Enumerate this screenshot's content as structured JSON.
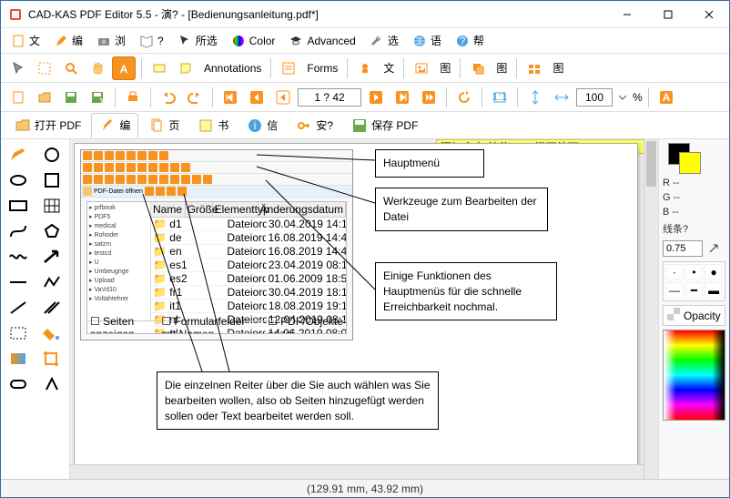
{
  "window": {
    "title": "CAD-KAS PDF Editor 5.5 - 演? - [Bedienungsanleitung.pdf*]"
  },
  "menu": {
    "file": "文",
    "edit": "编",
    "tools": "浏",
    "help": "?",
    "select": "所选",
    "color": "Color",
    "advanced": "Advanced",
    "options": "选",
    "lang": "语",
    "help2": "帮"
  },
  "toolbar1": {
    "annotations": "Annotations",
    "forms": "Forms",
    "text": "文",
    "pic": "图",
    "pic2": "图",
    "pic3": "图"
  },
  "toolbar2": {
    "page_field": "1 ? 42",
    "zoom_value": "100",
    "zoom_pct": "%"
  },
  "tabs": {
    "open_pdf": "打开 PDF",
    "edit": "编",
    "pages": "页",
    "bookmarks": "书",
    "info": "信",
    "security": "安?",
    "save_pdf": "保存 PDF"
  },
  "yellow_hint": "添加文本(按住 ALT 键不放可",
  "callouts": {
    "c1": "Hauptmenü",
    "c2": "Werkzeuge zum Bearbeiten der Datei",
    "c3": "Einige Funktionen des Hauptmenüs für die schnelle Erreichbarkeit nochmal.",
    "c4": "Die einzelnen Reiter über die Sie auch wählen was Sie bearbeiten wollen, also ob Seiten hinzugefügt werden sollen oder Text bearbeitet werden soll."
  },
  "rightpanel": {
    "r": "R --",
    "g": "G --",
    "b": "B --",
    "linewidth_label": "线条?",
    "linewidth_value": "0.75",
    "opacity": "Opacity"
  },
  "status": "(129.91 mm, 43.92 mm)",
  "embed_cols": {
    "c1": "Name",
    "c2": "Größe",
    "c3": "Elementtyp",
    "c4": "Änderungsdatum"
  }
}
